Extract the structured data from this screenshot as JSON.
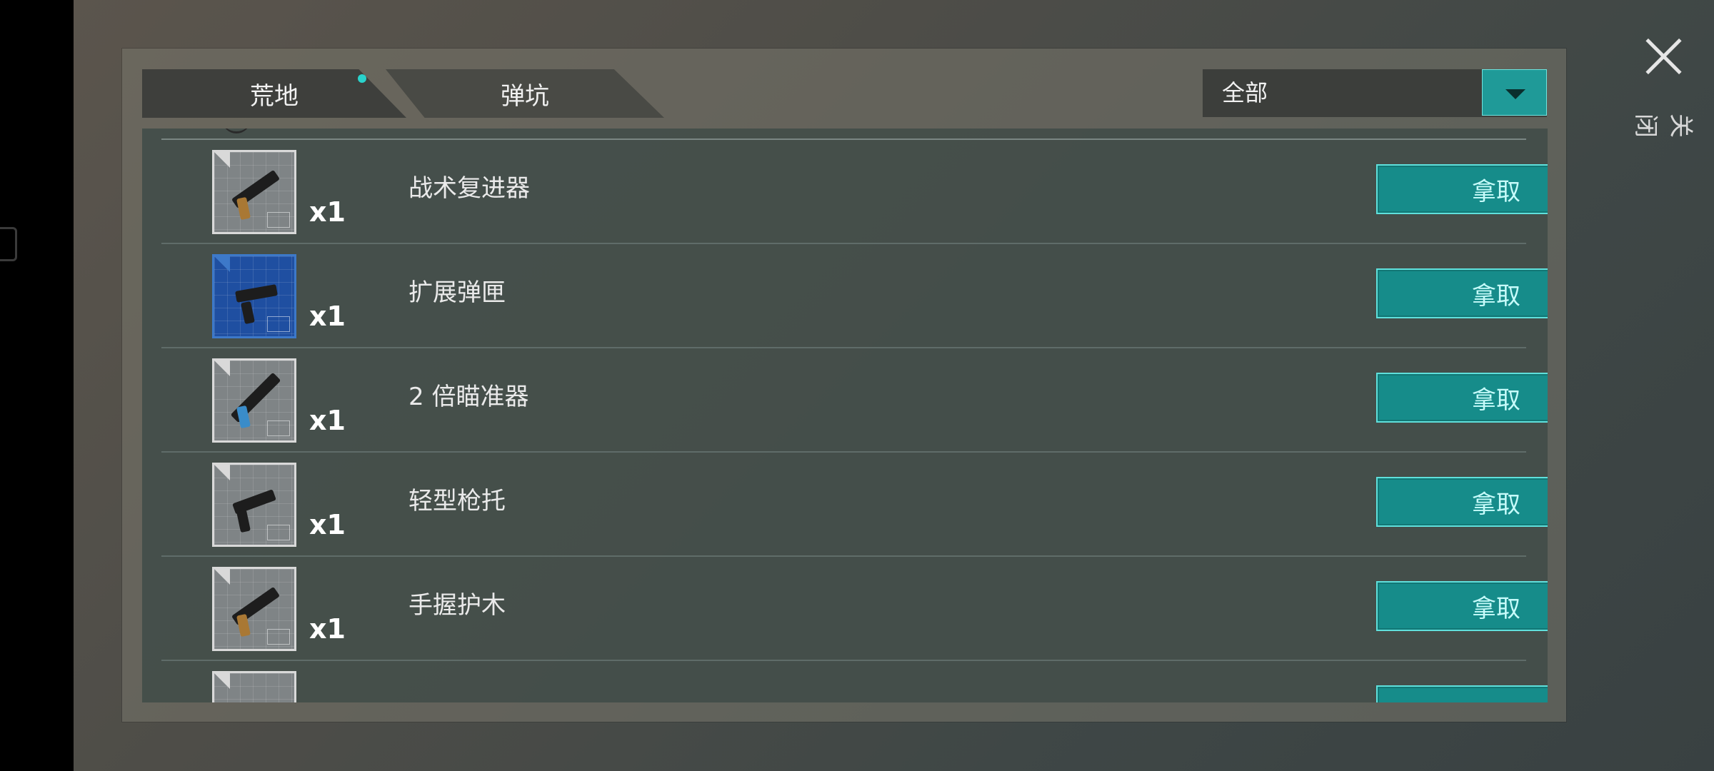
{
  "tabs": [
    {
      "label": "荒地",
      "active": true,
      "has_dot": true
    },
    {
      "label": "弹坑",
      "active": false
    }
  ],
  "filter": {
    "selected": "全部",
    "icon": "chevron-down-icon"
  },
  "close": {
    "label": "关闭",
    "icon": "close-icon"
  },
  "items": [
    {
      "name": "战术复进器",
      "qty": "x1",
      "icon": "shotgun-blueprint",
      "icon_style": "grey",
      "action": "拿取"
    },
    {
      "name": "扩展弹匣",
      "qty": "x1",
      "icon": "pistol-blueprint",
      "icon_style": "blue",
      "action": "拿取"
    },
    {
      "name": "2 倍瞄准器",
      "qty": "x1",
      "icon": "rifle-blueprint",
      "icon_style": "grey",
      "action": "拿取"
    },
    {
      "name": "轻型枪托",
      "qty": "x1",
      "icon": "smg-blueprint",
      "icon_style": "grey",
      "action": "拿取"
    },
    {
      "name": "手握护木",
      "qty": "x1",
      "icon": "shotgun-blueprint",
      "icon_style": "grey",
      "action": "拿取"
    }
  ],
  "colors": {
    "accent": "#168c8a",
    "accent_border": "#5fe0dc",
    "dot": "#2ad3cc",
    "blueprint_blue": "#1f4fa1"
  }
}
